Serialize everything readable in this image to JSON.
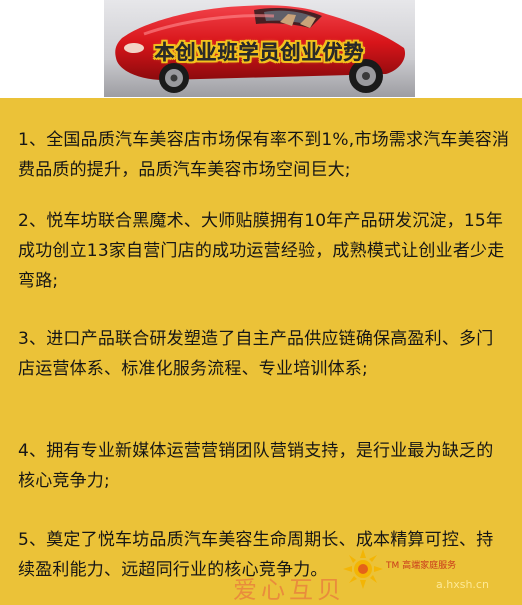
{
  "banner": {
    "title": "本创业班学员创业优势"
  },
  "advantages": [
    "1、全国品质汽车美容店市场保有率不到1%,市场需求汽车美容消费品质的提升，品质汽车美容市场空间巨大;",
    "2、悦车坊联合黑魔术、大师贴膜拥有10年产品研发沉淀，15年成功创立13家自营门店的成功运营经验，成熟模式让创业者少走弯路;",
    "3、进口产品联合研发塑造了自主产品供应链确保高盈利、多门店运营体系、标准化服务流程、专业培训体系;",
    "4、拥有专业新媒体运营营销团队营销支持，是行业最为缺乏的核心竞争力;",
    "5、奠定了悦车坊品质汽车美容生命周期长、成本精算可控、持续盈利能力、远超同行业的核心竞争力。"
  ],
  "watermark": {
    "text": "爱心互贝",
    "brand": "TM 高端家庭服务",
    "faint": "a.hxsh.cn"
  },
  "colors": {
    "panel": "#ebc238",
    "text": "#161616",
    "car": "#d8151a",
    "banner_title_outline": "#f3c21e"
  },
  "icons": {
    "banner_image": "red-sports-car",
    "watermark_logo": "sun-logo"
  }
}
